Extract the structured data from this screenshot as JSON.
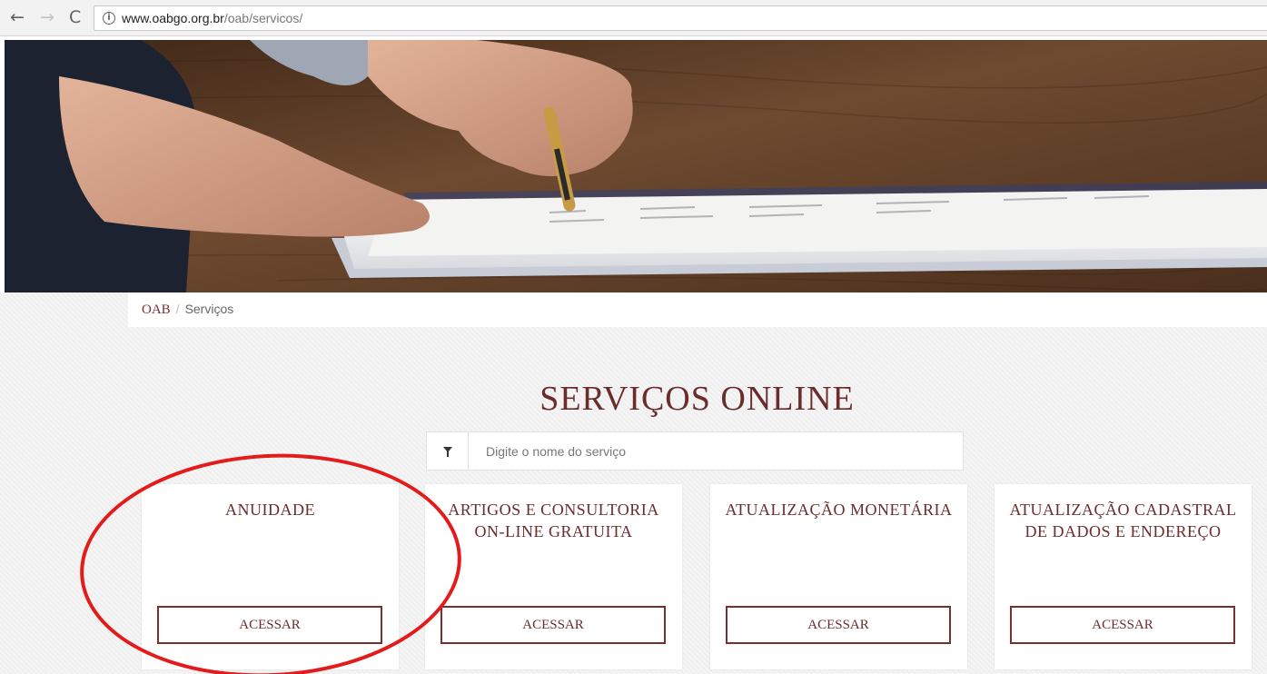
{
  "browser": {
    "url_domain": "www.oabgo.org.br",
    "url_path": "/oab/servicos/",
    "back_glyph": "←",
    "forward_glyph": "→",
    "reload_glyph": "C",
    "info_glyph": "i"
  },
  "breadcrumb": {
    "home": "OAB",
    "separator": "/",
    "current": "Serviços"
  },
  "page": {
    "title": "SERVIÇOS ONLINE"
  },
  "search": {
    "placeholder": "Digite o nome do serviço"
  },
  "cards": [
    {
      "title": "ANUIDADE",
      "button": "ACESSAR"
    },
    {
      "title": "ARTIGOS E CONSULTORIA ON-LINE GRATUITA",
      "button": "ACESSAR"
    },
    {
      "title": "ATUALIZAÇÃO MONETÁRIA",
      "button": "ACESSAR"
    },
    {
      "title": "ATUALIZAÇÃO CADASTRAL DE DADOS E ENDEREÇO",
      "button": "ACESSAR"
    }
  ],
  "colors": {
    "brand": "#6b2c2c",
    "annotation": "#e31b1b"
  }
}
